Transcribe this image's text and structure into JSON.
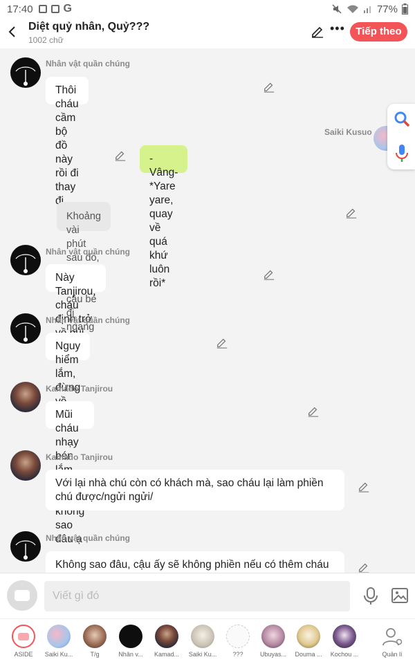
{
  "status_bar": {
    "time": "17:40",
    "battery": "77%"
  },
  "header": {
    "title": "Diệt quỷ nhân, Quỷ???",
    "subtitle": "1002 chữ",
    "next_label": "Tiếp theo"
  },
  "messages": [
    {
      "name": "Nhân vật quần chúng",
      "text": "Thôi cháu cầm bộ đồ này rồi đi thay đi"
    },
    {
      "name": "Saiki Kusuo",
      "text": "-Vâng- *Yare yare, quay về quá khứ luôn rồi*"
    },
    {
      "text": "Khoảng vài phút sau đó, cũng có một cậu bé đi ngang qua"
    },
    {
      "name": "Nhân vật quần chúng",
      "text": "Này Tanjirou, cháu định trở về núi đó à"
    },
    {
      "name": "Nhân vật quần chúng",
      "text": "Nguy hiểm lắm, đừng về nữa"
    },
    {
      "name": "Kamado Tanjirou",
      "text": "Mũi cháu nhạy bén lắm nên sẽ không sao đâu ạ"
    },
    {
      "name": "Kamado Tanjirou",
      "text": "Với lại nhà chú còn có khách mà, sao cháu lại làm phiền chú được/ngửi ngửi/"
    },
    {
      "name": "Nhân vật quần chúng",
      "text": "Không sao đâu, cậu ấy sẽ không phiền nếu có thêm cháu"
    }
  ],
  "input": {
    "placeholder": "Viết gì đó"
  },
  "characters": [
    {
      "label": "ASIDE"
    },
    {
      "label": "Saiki Ku..."
    },
    {
      "label": "T/g"
    },
    {
      "label": "Nhân v..."
    },
    {
      "label": "Kamad..."
    },
    {
      "label": "Saiki Ku..."
    },
    {
      "label": "???"
    },
    {
      "label": "Ubuyas..."
    },
    {
      "label": "Douma ..."
    },
    {
      "label": "Kochou ..."
    },
    {
      "label": "Quản lí"
    }
  ],
  "colors": {
    "accent": "#f25457",
    "own_bubble": "#d6f28d",
    "narration_bubble": "#e8e8e8"
  }
}
